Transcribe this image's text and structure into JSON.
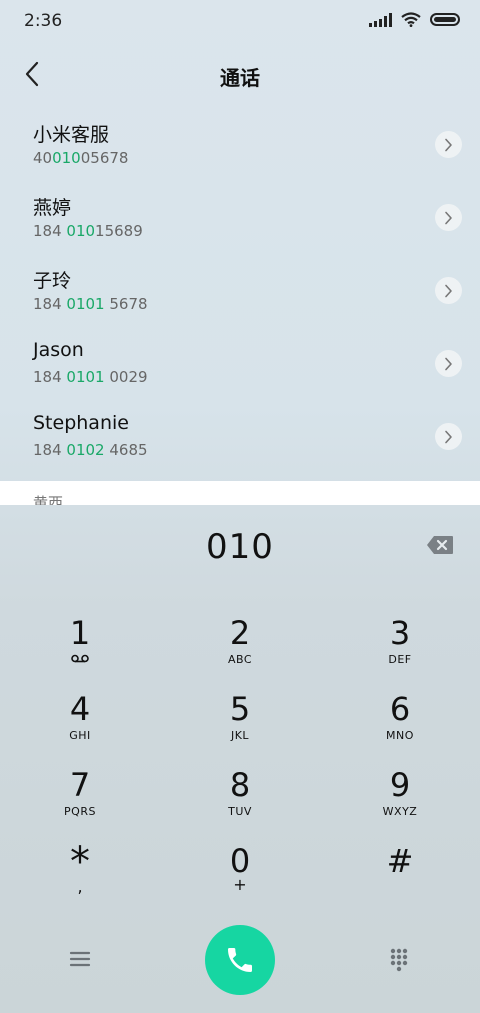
{
  "status_bar": {
    "time": "2:36"
  },
  "header": {
    "title": "通话"
  },
  "contacts": [
    {
      "name": "小米客服",
      "number_pre": "40",
      "number_match": "010",
      "number_post": "05678"
    },
    {
      "name": "燕婷",
      "number_pre": "184 ",
      "number_match": "010",
      "number_post": "15689"
    },
    {
      "name": "子玲",
      "number_pre": "184 ",
      "number_match": "0101",
      "number_post": " 5678"
    },
    {
      "name": "Jason",
      "number_pre": "184 ",
      "number_match": "0101",
      "number_post": " 0029"
    },
    {
      "name": "Stephanie",
      "number_pre": "184 ",
      "number_match": "0102",
      "number_post": " 4685"
    }
  ],
  "partial_label": "黄西",
  "dialer": {
    "input_value": "010",
    "keys": [
      {
        "digit": "1",
        "letters": ""
      },
      {
        "digit": "2",
        "letters": "ABC"
      },
      {
        "digit": "3",
        "letters": "DEF"
      },
      {
        "digit": "4",
        "letters": "GHI"
      },
      {
        "digit": "5",
        "letters": "JKL"
      },
      {
        "digit": "6",
        "letters": "MNO"
      },
      {
        "digit": "7",
        "letters": "PQRS"
      },
      {
        "digit": "8",
        "letters": "TUV"
      },
      {
        "digit": "9",
        "letters": "WXYZ"
      },
      {
        "digit": "*",
        "letters": ","
      },
      {
        "digit": "0",
        "letters": "+"
      },
      {
        "digit": "#",
        "letters": ""
      }
    ]
  },
  "icons": {
    "back": "chevron-left-icon",
    "detail": "chevron-right-icon",
    "backspace": "backspace-icon",
    "voicemail": "voicemail-icon",
    "menu": "menu-icon",
    "call": "phone-icon",
    "keypad": "keypad-grid-icon"
  },
  "colors": {
    "match_highlight": "#1aa868",
    "call_button": "#16d6a2"
  }
}
